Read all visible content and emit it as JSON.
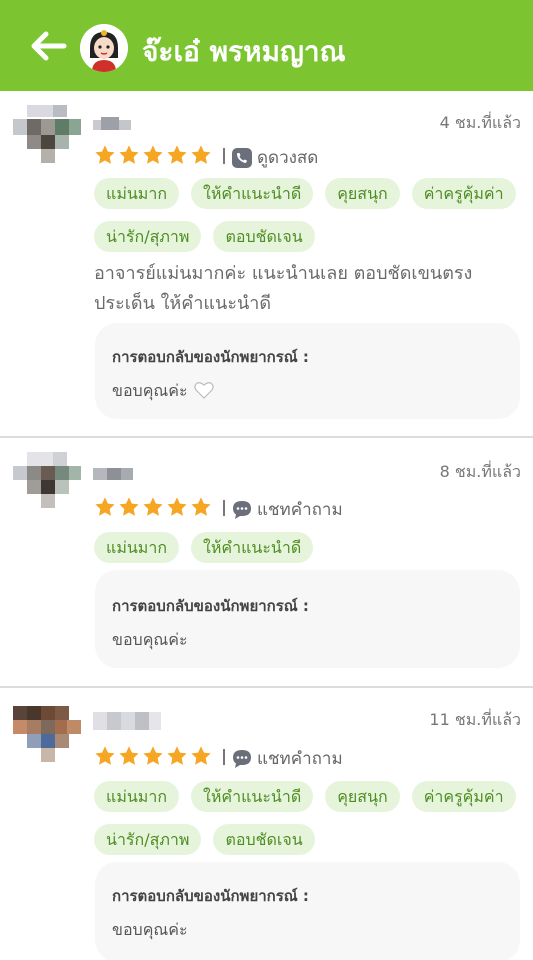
{
  "header": {
    "title": "จ๊ะเอ๋ พรหมญาณ",
    "colors": {
      "bar": "#7cc530"
    }
  },
  "reviews": [
    {
      "time": "4 ชม.ที่แล้ว",
      "rating": 5,
      "source": "ดูดวงสด",
      "source_icon": "phone-video-icon",
      "tags": [
        "แม่นมาก",
        "ให้คำแนะนำดี",
        "คุยสนุก",
        "ค่าครูคุ้มค่า",
        "น่ารัก/สุภาพ",
        "ตอบชัดเจน"
      ],
      "comment": "อาจารย์แม่นมากค่ะ แนะนำนเลย ตอบชัดเขนตรง ประเด็น ให้คำแนะนำดี",
      "reply_label": "การตอบกลับของนักพยากรณ์ :",
      "reply_text": "ขอบคุณค่ะ"
    },
    {
      "time": "8 ชม.ที่แล้ว",
      "rating": 5,
      "source": "แชทคำถาม",
      "source_icon": "chat-bubble-icon",
      "tags": [
        "แม่นมาก",
        "ให้คำแนะนำดี"
      ],
      "reply_label": "การตอบกลับของนักพยากรณ์ :",
      "reply_text": "ขอบคุณค่ะ"
    },
    {
      "time": "11 ชม.ที่แล้ว",
      "rating": 5,
      "source": "แชทคำถาม",
      "source_icon": "chat-bubble-icon",
      "tags": [
        "แม่นมาก",
        "ให้คำแนะนำดี",
        "คุยสนุก",
        "ค่าครูคุ้มค่า",
        "น่ารัก/สุภาพ",
        "ตอบชัดเจน"
      ],
      "reply_label": "การตอบกลับของนักพยากรณ์ :",
      "reply_text": "ขอบคุณค่ะ"
    }
  ],
  "colors": {
    "star": "#f5a623",
    "tag_bg": "#e6f4dc",
    "tag_text": "#4e8d22",
    "reply_bg": "#f7f7f7"
  }
}
